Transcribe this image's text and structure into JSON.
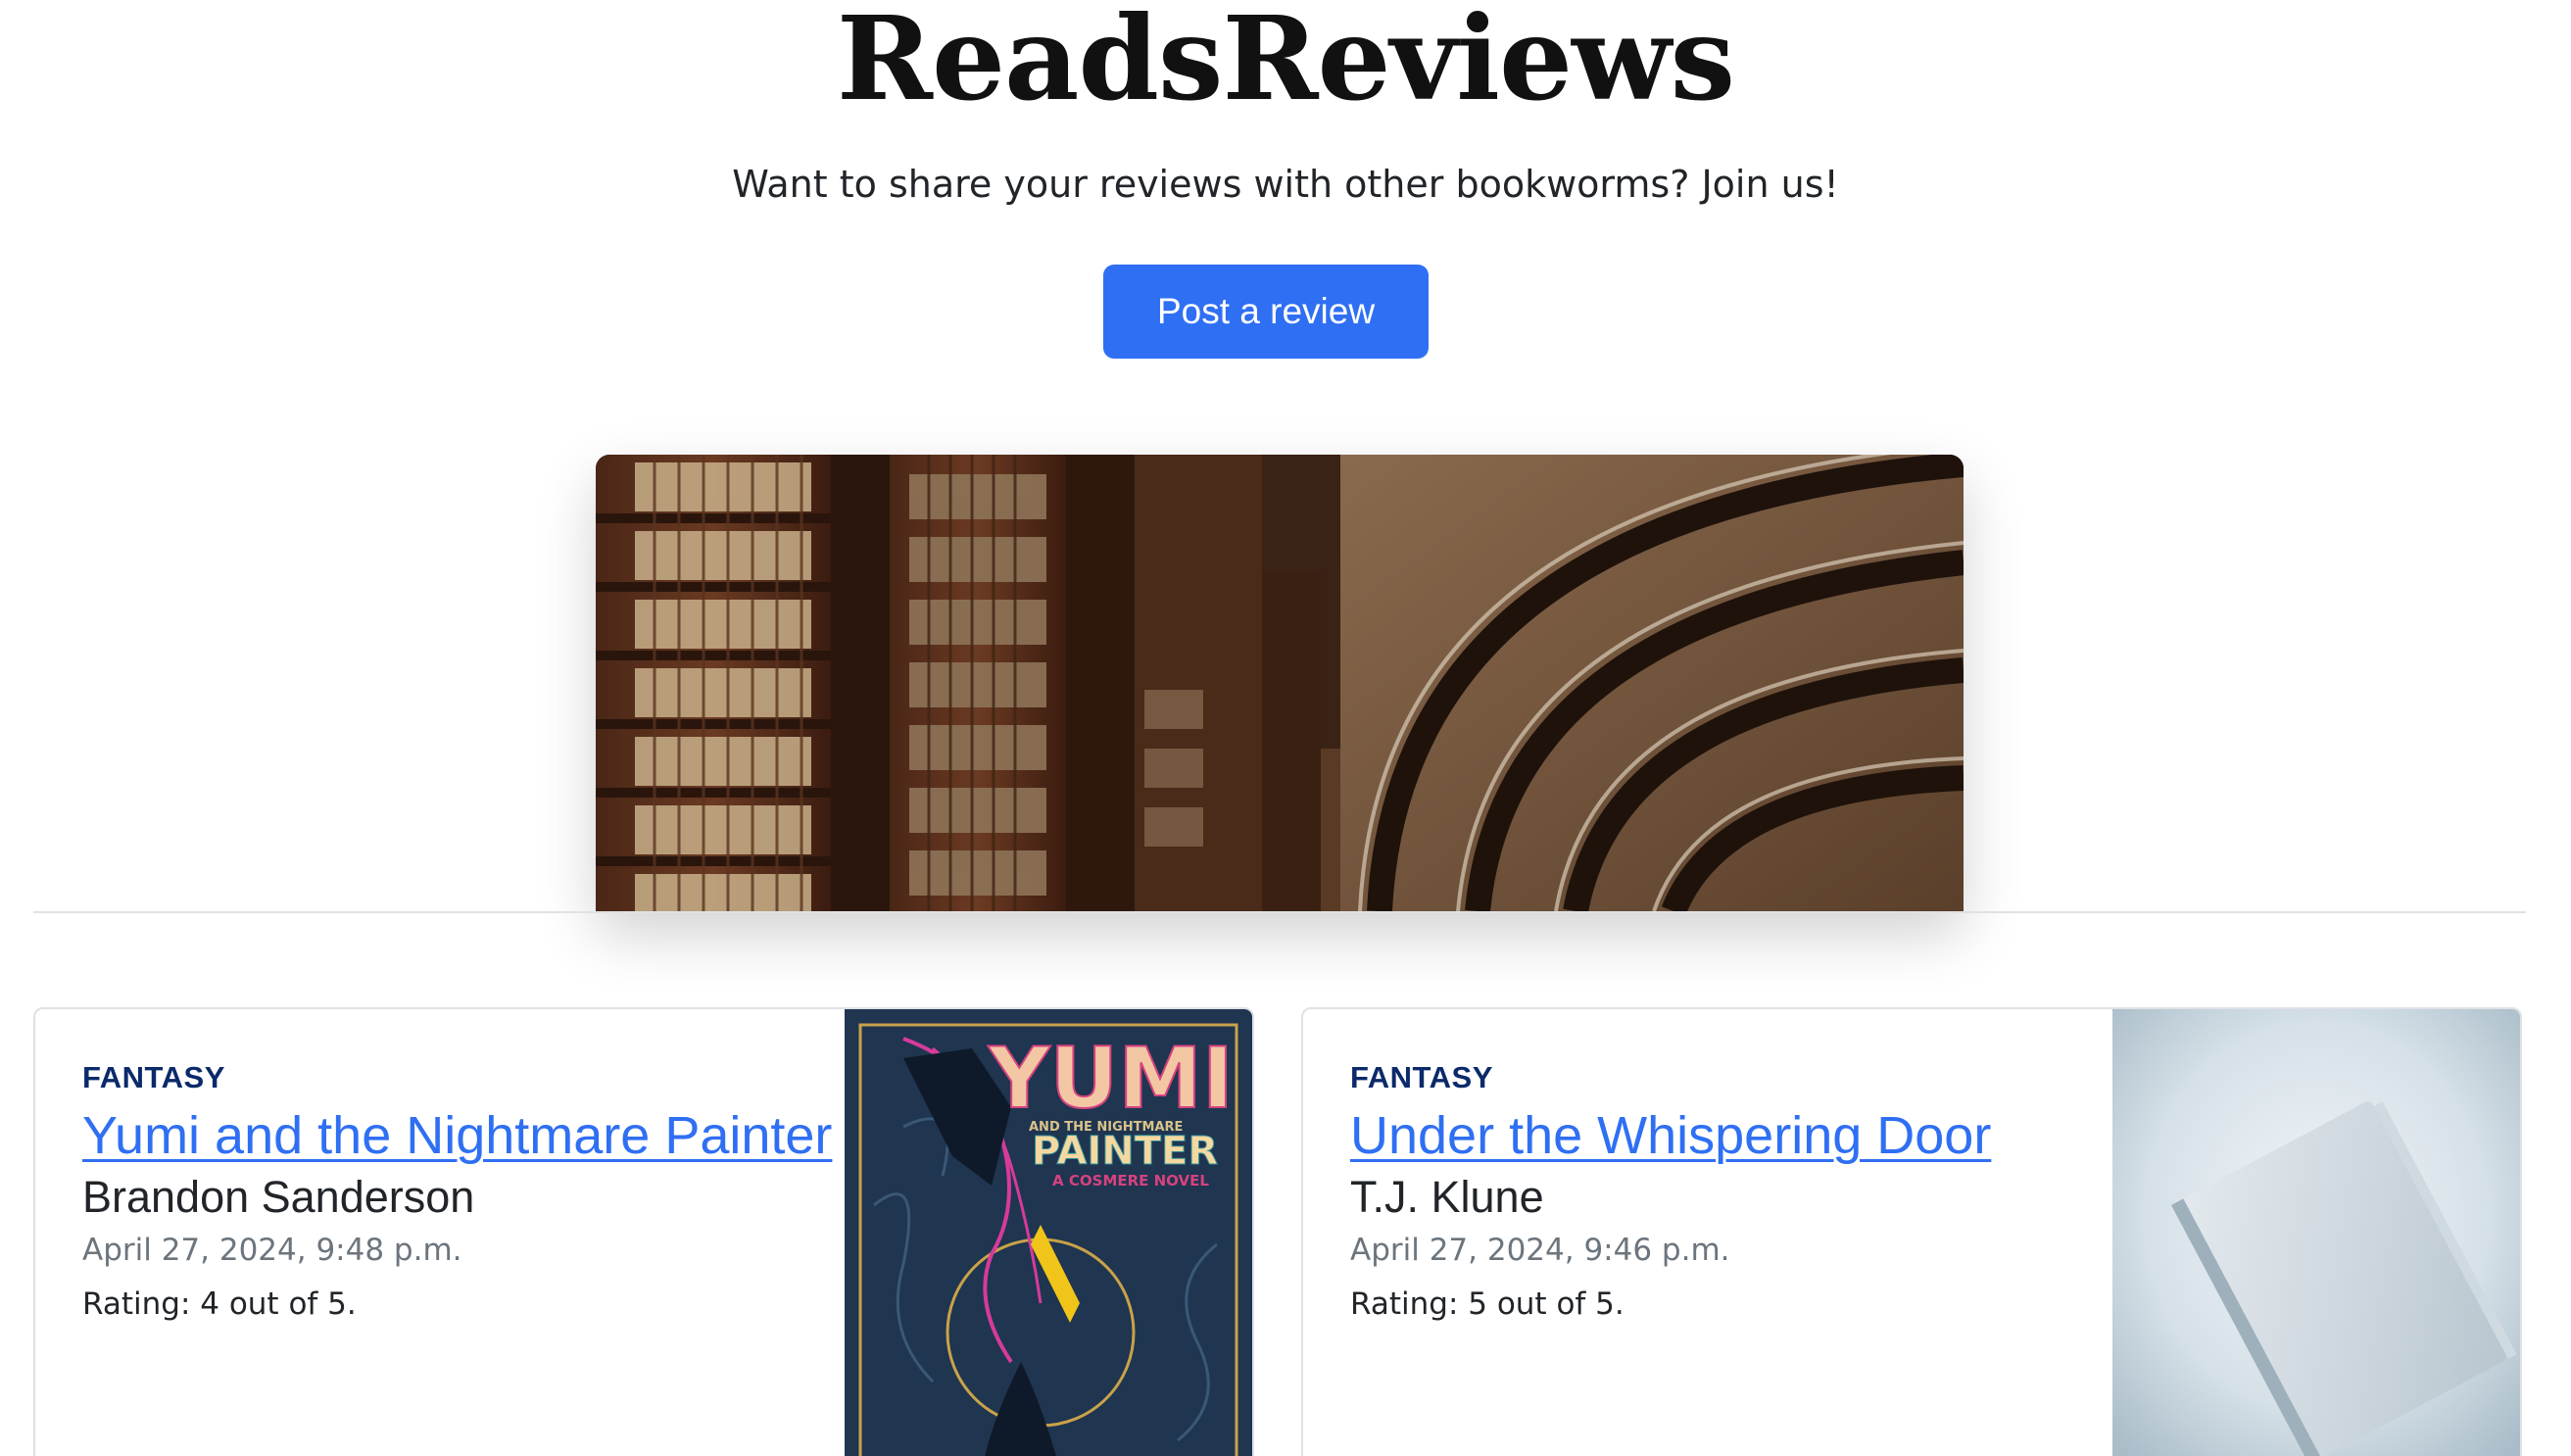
{
  "hero": {
    "title": "ReadsReviews",
    "tagline": "Want to share your reviews with other bookworms? Join us!",
    "post_button_label": "Post a review",
    "image_alt": "Library bookshelves with arched ceiling"
  },
  "reviews": [
    {
      "category": "FANTASY",
      "title": "Yumi and the Nightmare Painter",
      "author": "Brandon Sanderson",
      "date": "April 27, 2024, 9:48 p.m.",
      "rating": "Rating: 4 out of 5.",
      "cover": {
        "title_line1": "YUMI",
        "subtitle": "AND THE NIGHTMARE",
        "title_line2": "PAINTER",
        "series": "A COSMERE NOVEL"
      }
    },
    {
      "category": "FANTASY",
      "title": "Under the Whispering Door",
      "author": "T.J. Klune",
      "date": "April 27, 2024, 9:46 p.m.",
      "rating": "Rating: 5 out of 5."
    }
  ],
  "colors": {
    "accent": "#2f6ff3",
    "category": "#0b2a6b",
    "muted": "#6c757d",
    "border": "#dee2e6"
  }
}
